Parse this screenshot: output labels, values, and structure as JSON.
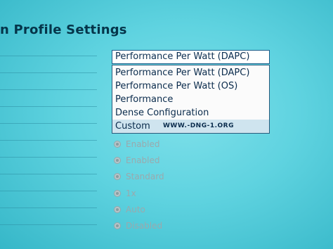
{
  "page": {
    "title": "n Profile Settings"
  },
  "profile_dropdown": {
    "selected": "Performance Per Watt (DAPC)",
    "options": [
      "Performance Per Watt (DAPC)",
      "Performance Per Watt (OS)",
      "Performance",
      "Dense Configuration",
      "Custom"
    ],
    "highlighted_index": 4,
    "watermark": "WWW.-DNG-1.ORG"
  },
  "settings_values": [
    "Enabled",
    "Enabled",
    "Standard",
    "1x",
    "Auto",
    "Disabled"
  ]
}
